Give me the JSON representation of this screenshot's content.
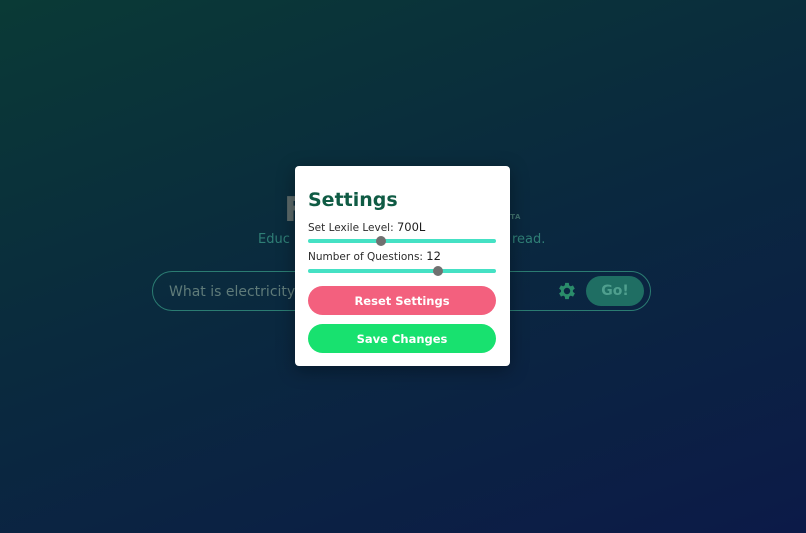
{
  "background": {
    "brand_initial": "F",
    "beta_tag": "ETA",
    "tagline_left": "Educ",
    "tagline_right": "read.",
    "search": {
      "placeholder": "What is electricity?",
      "go_label": "Go!"
    },
    "settings_icon": "gear-icon"
  },
  "modal": {
    "title": "Settings",
    "lexile": {
      "label": "Set Lexile Level:",
      "value": "700L",
      "slider_fraction": 0.39
    },
    "questions": {
      "label": "Number of Questions:",
      "value": "12",
      "slider_fraction": 0.69
    },
    "reset_label": "Reset Settings",
    "save_label": "Save Changes"
  },
  "colors": {
    "title": "#0f5b44",
    "slider_track": "#45e1c4",
    "reset_button": "#f3607e",
    "save_button": "#18e16f",
    "go_button": "#1f6e63"
  }
}
